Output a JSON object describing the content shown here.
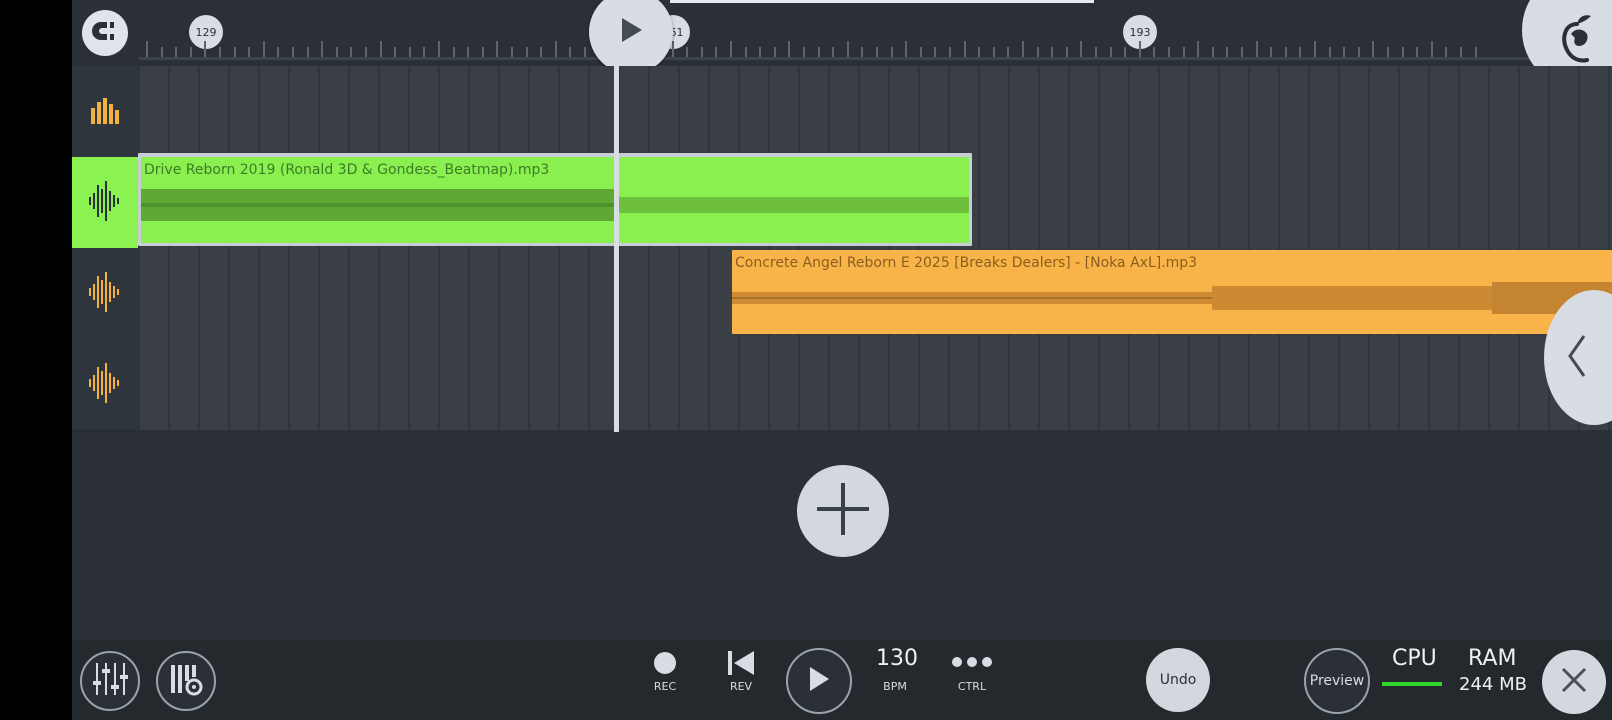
{
  "ruler": {
    "markers": [
      "129",
      "161",
      "193"
    ]
  },
  "tracks": [
    {
      "type": "playlist"
    },
    {
      "type": "audio",
      "clip_title": "Drive Reborn 2019 (Ronald 3D & Gondess_Beatmap).mp3",
      "color": "#89f04f"
    },
    {
      "type": "audio",
      "clip_title": "Concrete Angel Reborn E 2025 [Breaks Dealers] -  [Noka AxL].mp3",
      "color": "#f9b449"
    },
    {
      "type": "audio"
    }
  ],
  "transport": {
    "rec_label": "REC",
    "rev_label": "REV",
    "bpm_value": "130",
    "bpm_label": "BPM",
    "ctrl_label": "CTRL",
    "undo_label": "Undo",
    "preview_label": "Preview",
    "cpu_label": "CPU",
    "ram_label": "RAM",
    "ram_value": "244 MB"
  },
  "colors": {
    "accent_green": "#89f04f",
    "accent_orange": "#f9b449",
    "background": "#2b3036"
  }
}
